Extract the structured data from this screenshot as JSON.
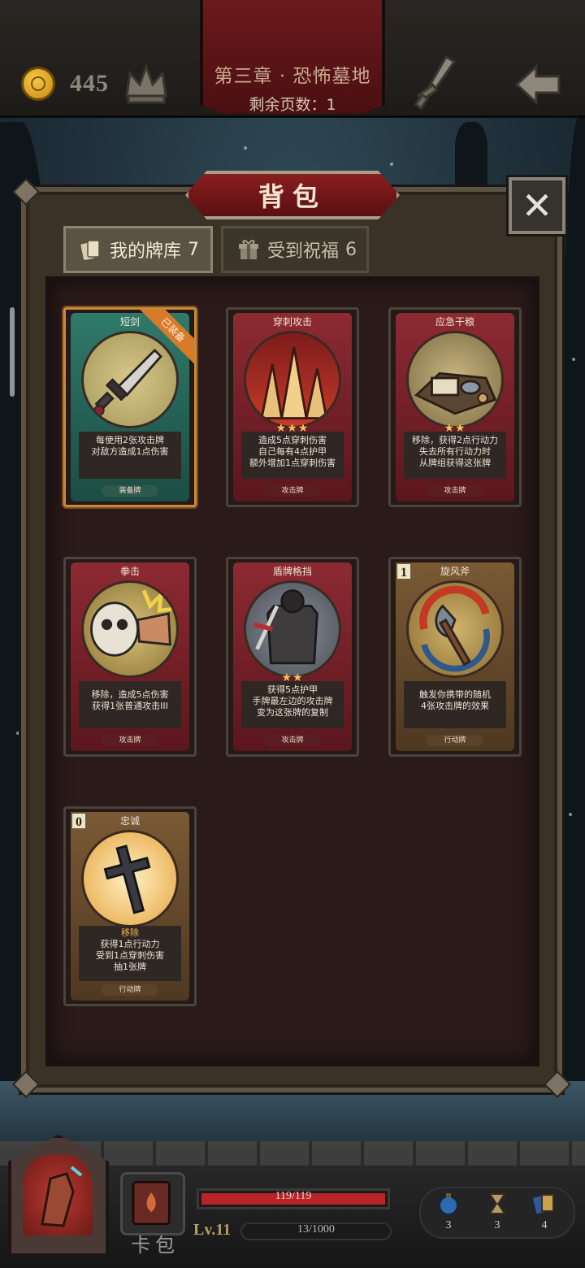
{
  "topbar": {
    "gold": "445",
    "chapter_title": "第三章 · 恐怖墓地",
    "pages_left": "剩余页数：1"
  },
  "panel": {
    "title": "背包",
    "close_label": "✕"
  },
  "tabs": [
    {
      "label": "我的牌库",
      "count": "7",
      "active": true
    },
    {
      "label": "受到祝福",
      "count": "6",
      "active": false
    }
  ],
  "cards": [
    {
      "name": "短剑",
      "desc": [
        "每使用2张攻击牌",
        "对敌方造成1点伤害"
      ],
      "type": "装备牌",
      "stars": "",
      "cost": "",
      "ribbon": "已装备"
    },
    {
      "name": "穿刺攻击",
      "desc": [
        "造成5点穿刺伤害",
        "自己每有4点护甲",
        "额外增加1点穿刺伤害"
      ],
      "type": "攻击牌",
      "stars": "★★★",
      "cost": ""
    },
    {
      "name": "应急干粮",
      "desc": [
        "移除，获得2点行动力",
        "失去所有行动力时",
        "从牌组获得这张牌"
      ],
      "type": "攻击牌",
      "stars": "★★",
      "cost": ""
    },
    {
      "name": "拳击",
      "desc": [
        "移除，造成5点伤害",
        "获得1张普通攻击III"
      ],
      "type": "攻击牌",
      "stars": "",
      "cost": ""
    },
    {
      "name": "盾牌格挡",
      "desc": [
        "获得5点护甲",
        "手牌最左边的攻击牌",
        "变为这张牌的复制"
      ],
      "type": "攻击牌",
      "stars": "★★",
      "cost": ""
    },
    {
      "name": "旋风斧",
      "desc": [
        "触发你携带的随机",
        "4张攻击牌的效果"
      ],
      "type": "行动牌",
      "stars": "",
      "cost": "1"
    },
    {
      "name": "忠诚",
      "desc": [
        "移除",
        "获得1点行动力",
        "受到1点穿刺伤害",
        "抽1张牌"
      ],
      "type": "行动牌",
      "stars": "",
      "cost": "0"
    }
  ],
  "bottom": {
    "hp": "119/119",
    "hp_ratio": 1.0,
    "level": "Lv.11",
    "xp": "13/1000",
    "deck_label": "卡包",
    "resources": [
      "3",
      "3",
      "4"
    ]
  },
  "colors": {
    "card_red": "#8d2a33",
    "card_teal": "#2f7a6a",
    "card_brown": "#7a5a35",
    "highlight": "#f2b84a",
    "hp": "#b82428"
  }
}
